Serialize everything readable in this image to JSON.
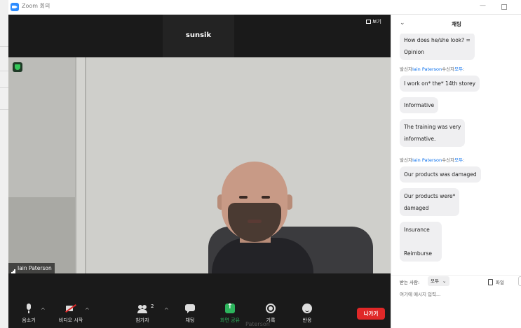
{
  "window": {
    "title": "Zoom 회의"
  },
  "meeting": {
    "active_speaker_name": "sunsik",
    "view_label": "보기",
    "participant_label": "Iain Paterson",
    "below_window_text": "Paterson"
  },
  "toolbar": {
    "mute_label": "음소거",
    "video_label": "비디오 시작",
    "participants_label": "참가자",
    "participants_count": "2",
    "chat_label": "채팅",
    "share_label": "화면 공유",
    "record_label": "기록",
    "reactions_label": "반응",
    "leave_label": "나가기",
    "caret": "^"
  },
  "chat": {
    "title": "채팅",
    "collapse_symbol": "⌄",
    "messages": [
      {
        "text_line1": "How does he/she look? =",
        "text_line2": "Opinion"
      },
      {
        "sender_prefix": "발신자",
        "sender_name": "Iain Paterson",
        "receiver_prefix": "수신자",
        "receiver_name": "모두",
        "suffix": ":"
      },
      {
        "text": "I work on* the* 14th storey"
      },
      {
        "text": "Informative"
      },
      {
        "text_line1": "The training was very",
        "text_line2": "informative."
      },
      {
        "sender_prefix": "발신자",
        "sender_name": "Iain Paterson",
        "receiver_prefix": "수신자",
        "receiver_name": "모두",
        "suffix": ":"
      },
      {
        "text": "Our products was damaged"
      },
      {
        "text_line1": "Our products were*",
        "text_line2": "damaged"
      },
      {
        "text_line1": "Insurance",
        "text_line2": "",
        "text_line3": "Reimburse"
      }
    ],
    "to_label": "받는 사람:",
    "to_value": "모두",
    "to_caret": "⌄",
    "file_label": "파일",
    "input_placeholder": "여기에 메시지 입력..."
  },
  "colors": {
    "meeting_bg": "#1a1a1a",
    "leave_red": "#e02828",
    "share_green": "#2db55d",
    "link_blue": "#0e72ed"
  }
}
